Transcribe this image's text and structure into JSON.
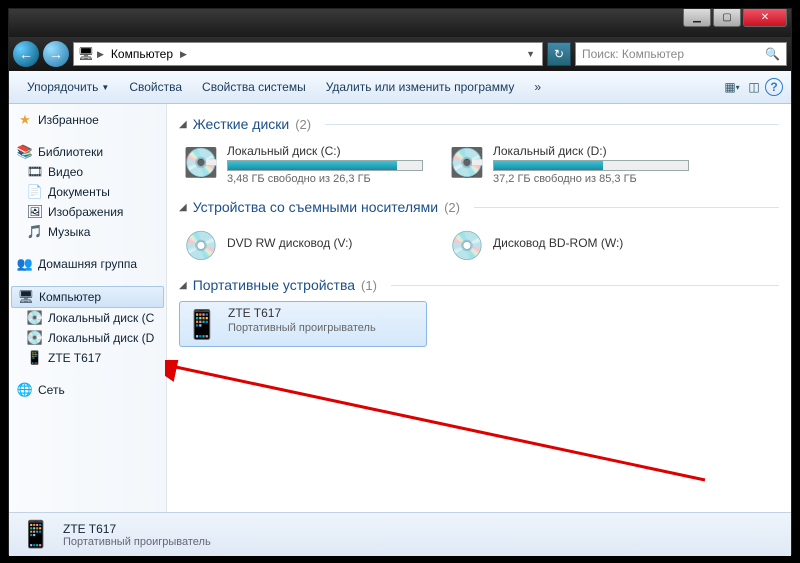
{
  "titlebar": {
    "min": "▁",
    "max": "▢",
    "close": "✕"
  },
  "nav": {
    "back": "←",
    "fwd": "→",
    "crumb_root_icon": "🖥",
    "crumb_root": "Компьютер",
    "refresh": "↻",
    "search_placeholder": "Поиск: Компьютер",
    "search_icon": "🔍"
  },
  "toolbar": {
    "organize": "Упорядочить",
    "properties": "Свойства",
    "sysprops": "Свойства системы",
    "uninstall": "Удалить или изменить программу",
    "more": "»",
    "view_icon": "▦",
    "pane_icon": "◫",
    "help_icon": "?"
  },
  "sidebar": {
    "favorites": {
      "icon": "★",
      "label": "Избранное"
    },
    "libraries": {
      "icon": "📚",
      "label": "Библиотеки"
    },
    "lib_items": [
      {
        "icon": "🎞",
        "label": "Видео"
      },
      {
        "icon": "📄",
        "label": "Документы"
      },
      {
        "icon": "🖼",
        "label": "Изображения"
      },
      {
        "icon": "🎵",
        "label": "Музыка"
      }
    ],
    "homegroup": {
      "icon": "👥",
      "label": "Домашняя группа"
    },
    "computer": {
      "icon": "🖥",
      "label": "Компьютер"
    },
    "comp_items": [
      {
        "icon": "💽",
        "label": "Локальный диск (C"
      },
      {
        "icon": "💽",
        "label": "Локальный диск (D"
      },
      {
        "icon": "📱",
        "label": "ZTE T617"
      }
    ],
    "network": {
      "icon": "🌐",
      "label": "Сеть"
    }
  },
  "groups": {
    "hdd": {
      "title": "Жесткие диски",
      "count": "(2)"
    },
    "removable": {
      "title": "Устройства со съемными носителями",
      "count": "(2)"
    },
    "portable": {
      "title": "Портативные устройства",
      "count": "(1)"
    }
  },
  "drives": {
    "c": {
      "name": "Локальный диск (C:)",
      "free": "3,48 ГБ свободно из 26,3 ГБ",
      "fill_pct": 87
    },
    "d": {
      "name": "Локальный диск (D:)",
      "free": "37,2 ГБ свободно из 85,3 ГБ",
      "fill_pct": 56
    },
    "dvd": {
      "name": "DVD RW дисковод (V:)"
    },
    "bd": {
      "name": "Дисковод BD-ROM (W:)"
    },
    "zte": {
      "name": "ZTE T617",
      "desc": "Портативный проигрыватель"
    }
  },
  "status": {
    "title": "ZTE T617",
    "subtitle": "Портативный проигрыватель"
  }
}
